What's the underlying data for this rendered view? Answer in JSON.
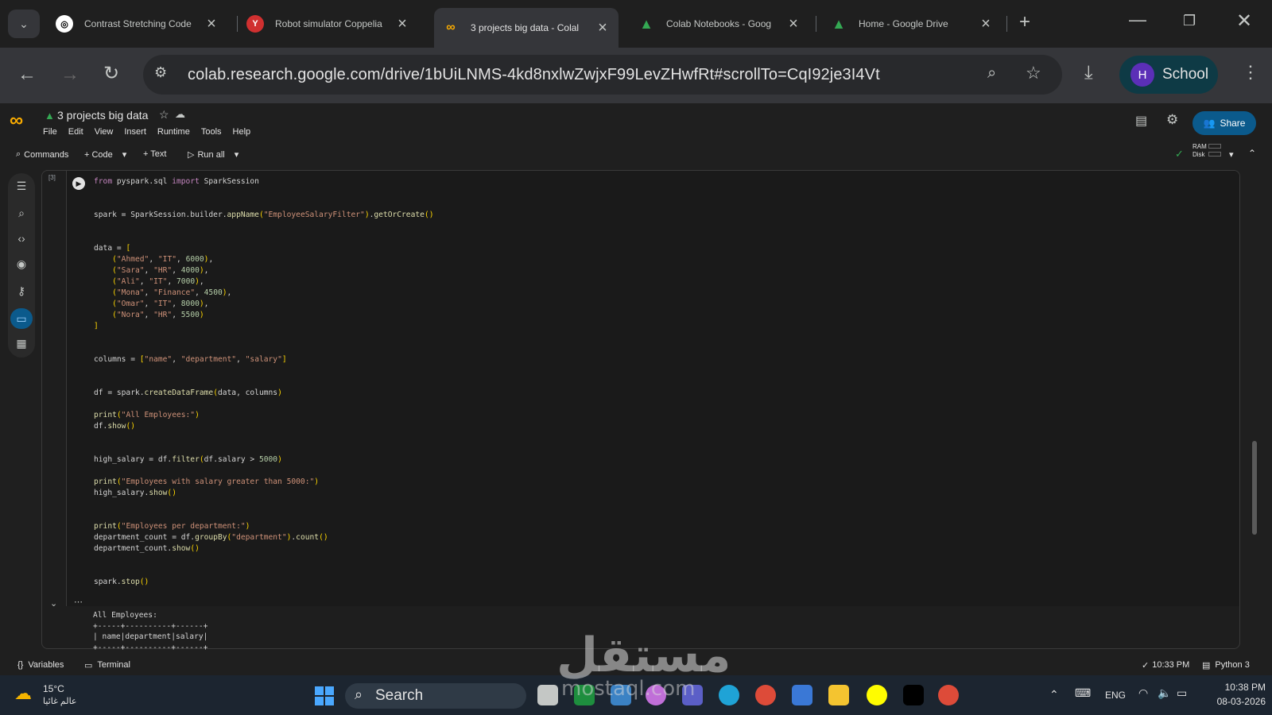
{
  "browser": {
    "tabs": [
      {
        "title": "Contrast Stretching Code",
        "icon": "chatgpt-icon"
      },
      {
        "title": "Robot simulator Coppelia",
        "icon": "coppelia-icon"
      },
      {
        "title": "3 projects big data - Colal",
        "icon": "colab-icon"
      },
      {
        "title": "Colab Notebooks - Goog",
        "icon": "google-drive-icon"
      },
      {
        "title": "Home - Google Drive",
        "icon": "google-drive-icon"
      }
    ],
    "url": "colab.research.google.com/drive/1bUiLNMS-4kd8nxlwZwjxF99LevZHwfRt#scrollTo=CqI92je3I4Vt",
    "profile_initial": "H",
    "profile_name": "School"
  },
  "colab": {
    "notebook_title": "3 projects big data",
    "menu": [
      "File",
      "Edit",
      "View",
      "Insert",
      "Runtime",
      "Tools",
      "Help"
    ],
    "share_label": "Share",
    "toolbar": {
      "commands": "Commands",
      "code": "+ Code",
      "text": "+ Text",
      "run_all": "Run all",
      "ram": "RAM",
      "disk": "Disk"
    },
    "cell_exec_count": "[3]",
    "output_lines": [
      "All Employees:",
      "+-----+----------+------+",
      "| name|department|salary|",
      "+-----+----------+------+"
    ],
    "status": {
      "variables": "Variables",
      "terminal": "Terminal",
      "time": "10:33 PM",
      "kernel": "Python 3"
    }
  },
  "taskbar": {
    "weather_temp": "15°C",
    "weather_text": "عالم غائيا",
    "search_label": "Search",
    "lang": "ENG",
    "clock_time": "10:38 PM",
    "clock_date": "08-03-2026"
  },
  "watermark": {
    "arabic": "مستقل",
    "latin": "mostaql.com"
  },
  "colors": {
    "accent": "#0b5a8c",
    "profile_bg": "#0e3a45",
    "avatar": "#5b2fb7"
  }
}
